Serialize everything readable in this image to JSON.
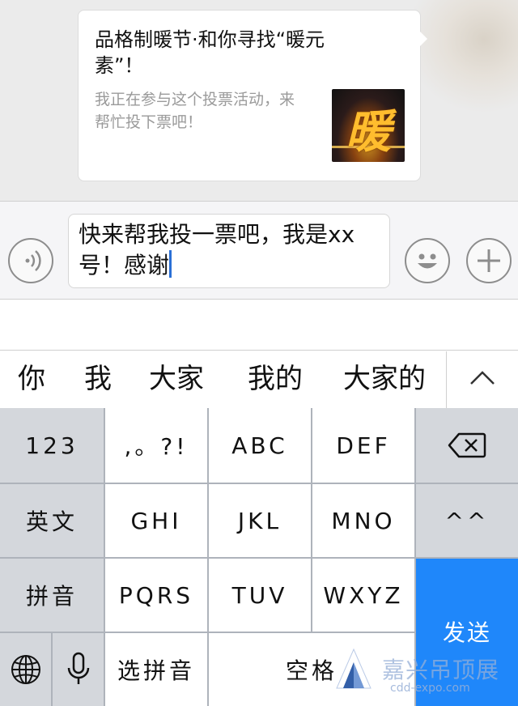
{
  "card": {
    "title": "品格制暖节·和你寻找“暖元素”！",
    "description": "我正在参与这个投票活动，来帮忙投下票吧！",
    "thumb_glyph": "暖"
  },
  "input": {
    "message": "快来帮我投一票吧，我是xx号！感谢",
    "icons": {
      "voice": "voice-icon",
      "emoji": "emoji-icon",
      "plus": "plus-icon"
    }
  },
  "candidates": {
    "items": [
      "你",
      "我",
      "大家",
      "我的",
      "大家的"
    ],
    "collapse": "^"
  },
  "keyboard": {
    "row1": [
      "123",
      ",。?!",
      "ABC",
      "DEF"
    ],
    "delete_icon": "delete-icon",
    "row2": [
      "英文",
      "GHI",
      "JKL",
      "MNO",
      "^^"
    ],
    "row3": [
      "拼音",
      "PQRS",
      "TUV",
      "WXYZ"
    ],
    "row4_select": "选拼音",
    "row4_space": "空格",
    "send": "发送",
    "globe_icon": "globe-icon",
    "mic_icon": "mic-icon",
    "accent_color": "#1f87fa"
  },
  "watermark": {
    "text": "嘉兴吊顶展",
    "url": "cdd-expo.com"
  }
}
